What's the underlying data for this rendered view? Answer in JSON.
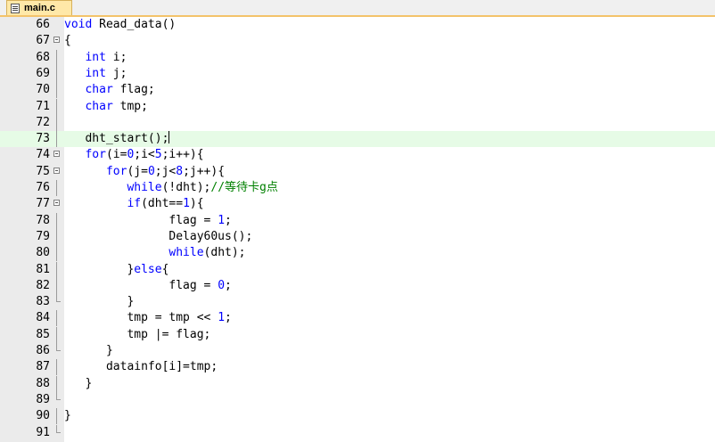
{
  "tab": {
    "label": "main.c"
  },
  "colors": {
    "keyword": "#0000ff",
    "comment": "#008000",
    "current_line_bg": "#e6fbe6"
  },
  "lines": [
    {
      "no": "66",
      "tokens": [
        [
          "kw",
          "void"
        ],
        [
          "t",
          " Read_data()"
        ]
      ]
    },
    {
      "no": "67",
      "tokens": [
        [
          "t",
          "{"
        ]
      ]
    },
    {
      "no": "68",
      "tokens": [
        [
          "t",
          "   "
        ],
        [
          "kw",
          "int"
        ],
        [
          "t",
          " i;"
        ]
      ]
    },
    {
      "no": "69",
      "tokens": [
        [
          "t",
          "   "
        ],
        [
          "kw",
          "int"
        ],
        [
          "t",
          " j;"
        ]
      ]
    },
    {
      "no": "70",
      "tokens": [
        [
          "t",
          "   "
        ],
        [
          "kw",
          "char"
        ],
        [
          "t",
          " flag;"
        ]
      ]
    },
    {
      "no": "71",
      "tokens": [
        [
          "t",
          "   "
        ],
        [
          "kw",
          "char"
        ],
        [
          "t",
          " tmp;"
        ]
      ]
    },
    {
      "no": "72",
      "tokens": []
    },
    {
      "no": "73",
      "tokens": [
        [
          "t",
          "   dht_start();"
        ]
      ],
      "current": true
    },
    {
      "no": "74",
      "tokens": [
        [
          "t",
          "   "
        ],
        [
          "kw",
          "for"
        ],
        [
          "t",
          "(i="
        ],
        [
          "num",
          "0"
        ],
        [
          "t",
          ";i<"
        ],
        [
          "num",
          "5"
        ],
        [
          "t",
          ";i++){"
        ]
      ]
    },
    {
      "no": "75",
      "tokens": [
        [
          "t",
          "      "
        ],
        [
          "kw",
          "for"
        ],
        [
          "t",
          "(j="
        ],
        [
          "num",
          "0"
        ],
        [
          "t",
          ";j<"
        ],
        [
          "num",
          "8"
        ],
        [
          "t",
          ";j++){"
        ]
      ]
    },
    {
      "no": "76",
      "tokens": [
        [
          "t",
          "         "
        ],
        [
          "kw",
          "while"
        ],
        [
          "t",
          "(!dht);"
        ],
        [
          "cm",
          "//等待卡g点"
        ]
      ]
    },
    {
      "no": "77",
      "tokens": [
        [
          "t",
          "         "
        ],
        [
          "kw",
          "if"
        ],
        [
          "t",
          "(dht=="
        ],
        [
          "num",
          "1"
        ],
        [
          "t",
          "){"
        ]
      ]
    },
    {
      "no": "78",
      "tokens": [
        [
          "t",
          "               flag = "
        ],
        [
          "num",
          "1"
        ],
        [
          "t",
          ";"
        ]
      ]
    },
    {
      "no": "79",
      "tokens": [
        [
          "t",
          "               Delay60us();"
        ]
      ]
    },
    {
      "no": "80",
      "tokens": [
        [
          "t",
          "               "
        ],
        [
          "kw",
          "while"
        ],
        [
          "t",
          "(dht);"
        ]
      ]
    },
    {
      "no": "81",
      "tokens": [
        [
          "t",
          "         }"
        ],
        [
          "kw",
          "else"
        ],
        [
          "t",
          "{"
        ]
      ]
    },
    {
      "no": "82",
      "tokens": [
        [
          "t",
          "               flag = "
        ],
        [
          "num",
          "0"
        ],
        [
          "t",
          ";"
        ]
      ]
    },
    {
      "no": "83",
      "tokens": [
        [
          "t",
          "         }"
        ]
      ]
    },
    {
      "no": "84",
      "tokens": [
        [
          "t",
          "         tmp = tmp << "
        ],
        [
          "num",
          "1"
        ],
        [
          "t",
          ";"
        ]
      ]
    },
    {
      "no": "85",
      "tokens": [
        [
          "t",
          "         tmp |= flag;"
        ]
      ]
    },
    {
      "no": "86",
      "tokens": [
        [
          "t",
          "      }"
        ]
      ]
    },
    {
      "no": "87",
      "tokens": [
        [
          "t",
          "      datainfo[i]=tmp;"
        ]
      ]
    },
    {
      "no": "88",
      "tokens": [
        [
          "t",
          "   }"
        ]
      ]
    },
    {
      "no": "89",
      "tokens": []
    },
    {
      "no": "90",
      "tokens": [
        [
          "t",
          "}"
        ]
      ]
    },
    {
      "no": "91",
      "tokens": []
    }
  ]
}
